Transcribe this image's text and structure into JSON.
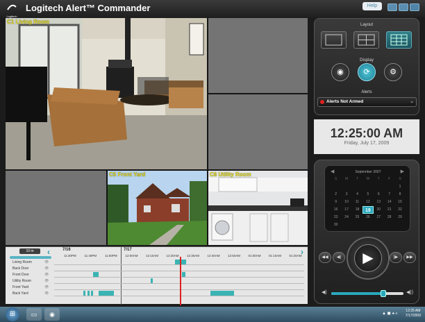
{
  "app": {
    "title": "Logitech Alert™ Commander",
    "logo_text": "Logitech",
    "help_label": "Help"
  },
  "cameras": {
    "living_room": "C1 Living Room",
    "front_yard": "C5 Front Yard",
    "utility_room": "C6 Utility Room"
  },
  "control_panel": {
    "layout_label": "Layout",
    "display_label": "Display",
    "alerts_label": "Alerts",
    "alerts_status": "Alerts Not Armed",
    "alerts_status_color": "#dd2222"
  },
  "clock": {
    "time": "12:25:00 AM",
    "date": "Friday, July 17, 2009"
  },
  "calendar": {
    "month": "September 2007",
    "weekdays": [
      "S",
      "M",
      "T",
      "W",
      "T",
      "F",
      "S"
    ],
    "rows": [
      [
        "",
        "",
        "",
        "",
        "",
        "",
        "1"
      ],
      [
        "2",
        "3",
        "4",
        "5",
        "6",
        "7",
        "8"
      ],
      [
        "9",
        "10",
        "11",
        "12",
        "13",
        "14",
        "15"
      ],
      [
        "16",
        "17",
        "18",
        "19",
        "20",
        "21",
        "22"
      ],
      [
        "23",
        "24",
        "25",
        "26",
        "27",
        "28",
        "29"
      ],
      [
        "30",
        "",
        "",
        "",
        "",
        "",
        ""
      ]
    ],
    "selected_day": "19"
  },
  "playback": {
    "play_symbol": "▶",
    "prev_symbol": "◀◀",
    "step_back_symbol": "◀|",
    "step_fwd_symbol": "|▶",
    "next_symbol": "▶▶",
    "volume_low": "◀)",
    "volume_high": "◀))",
    "volume_level": 0.72,
    "top_marker": "◂▸"
  },
  "timeline": {
    "zoom_label": "10 m",
    "date1": "7/16",
    "date2": "7/17",
    "ticks": [
      "11:30PM",
      "11:40PM",
      "11:50PM",
      "12:00AM",
      "12:10AM",
      "12:20AM",
      "12:30AM",
      "12:40AM",
      "12:50AM",
      "01:00AM",
      "01:10AM",
      "01:20AM"
    ],
    "cameras": [
      "Living Room",
      "Back Door",
      "Front Door",
      "Utility Room",
      "Front Yard",
      "Back Yard"
    ],
    "eye_icon": "👁",
    "left_arrow": "‹",
    "right_arrow": "›"
  },
  "taskbar": {
    "start_symbol": "⊞",
    "tray_text": "▲ ◼ ◂ ◃",
    "clock_time": "12:25 AM",
    "clock_date": "7/17/2009"
  },
  "colors": {
    "accent": "#2aa9bd",
    "timeline_segment": "#3bb3b3",
    "cursor": "#dd2222",
    "camera_label": "#e8e020"
  }
}
